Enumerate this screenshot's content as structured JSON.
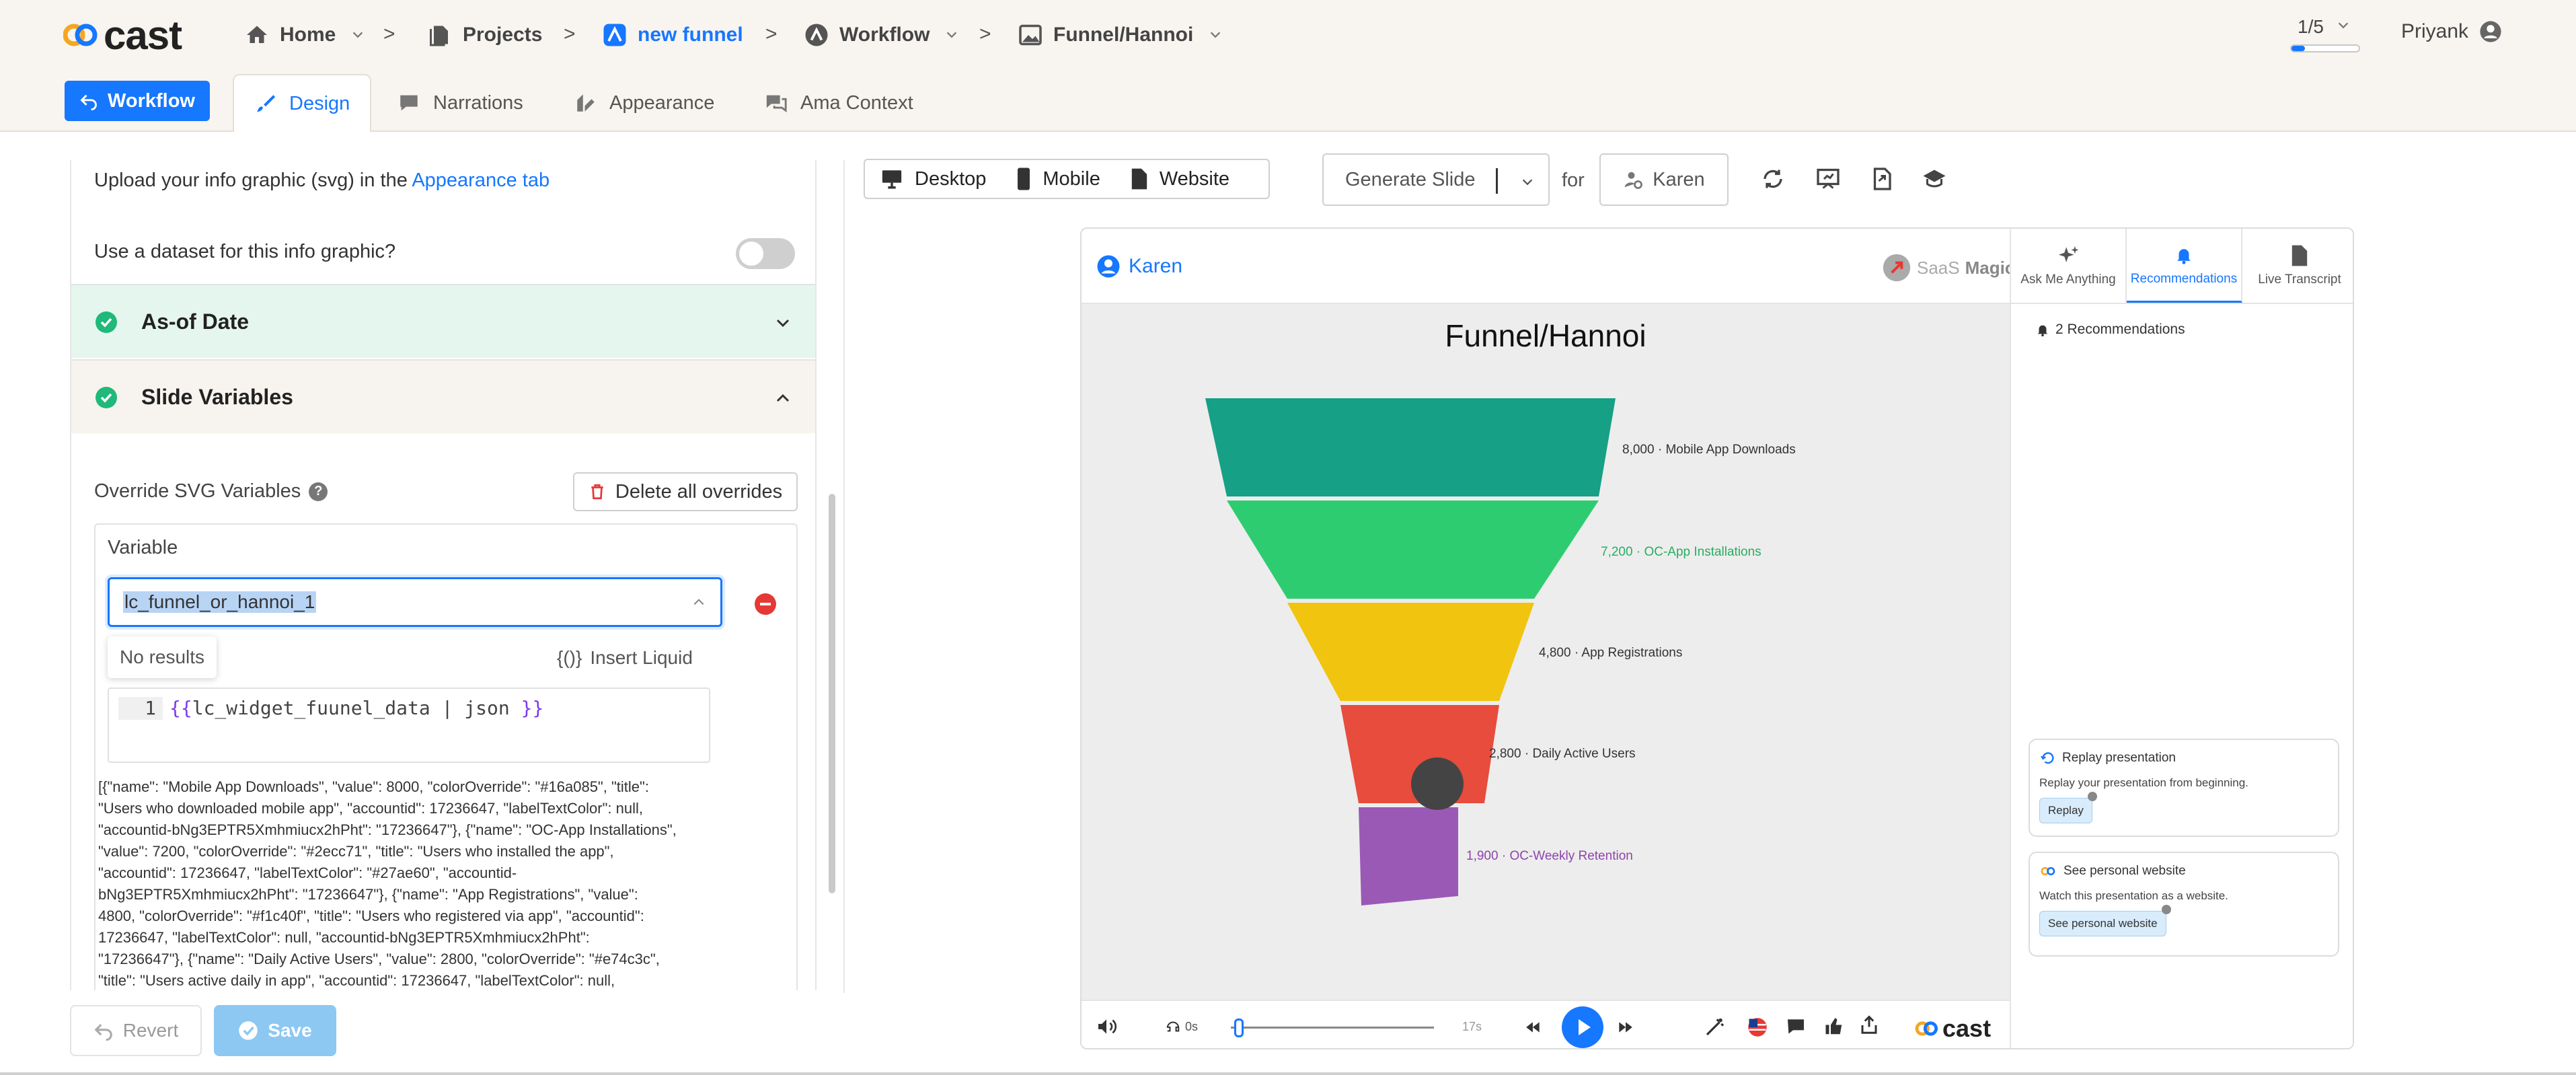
{
  "app": {
    "logo_text": "cast"
  },
  "breadcrumb": [
    {
      "label": "Home"
    },
    {
      "label": "Projects"
    },
    {
      "label": "new funnel"
    },
    {
      "label": "Workflow"
    },
    {
      "label": "Funnel/Hannoi"
    }
  ],
  "pager": {
    "text": "1/5",
    "progress": 0.2
  },
  "user": {
    "name": "Priyank"
  },
  "tabs": {
    "workflow_button": "Workflow",
    "items": [
      "Design",
      "Narrations",
      "Appearance",
      "Ama Context"
    ],
    "active": "Design"
  },
  "left_panel": {
    "upload_text": "Upload your info graphic (svg) in the",
    "upload_link": "Appearance tab",
    "dataset_question": "Use a dataset for this info graphic?",
    "dataset_enabled": false,
    "sections": [
      {
        "title": "As-of Date",
        "expanded": false
      },
      {
        "title": "Slide Variables",
        "expanded": true
      }
    ],
    "override_label": "Override SVG Variables",
    "help_icon": "?",
    "delete_all_label": "Delete all overrides",
    "variable_label": "Variable",
    "variable_value": "lc_funnel_or_hannoi_1",
    "no_results": "No results",
    "insert_liquid_icon": "{()}",
    "insert_liquid": "Insert Liquid",
    "code_line_number": "1",
    "code_open": "{{",
    "code_body": "lc_widget_fuunel_data | json ",
    "code_close": "}}",
    "json_preview": "[{\"name\": \"Mobile App Downloads\", \"value\": 8000, \"colorOverride\": \"#16a085\", \"title\": \"Users who downloaded mobile app\", \"accountid\": 17236647, \"labelTextColor\": null, \"accountid-bNg3EPTR5Xmhmiucx2hPht\": \"17236647\"}, {\"name\": \"OC-App Installations\", \"value\": 7200, \"colorOverride\": \"#2ecc71\", \"title\": \"Users who installed the app\", \"accountid\": 17236647, \"labelTextColor\": \"#27ae60\", \"accountid-bNg3EPTR5Xmhmiucx2hPht\": \"17236647\"}, {\"name\": \"App Registrations\", \"value\": 4800, \"colorOverride\": \"#f1c40f\", \"title\": \"Users who registered via app\", \"accountid\": 17236647, \"labelTextColor\": null, \"accountid-bNg3EPTR5Xmhmiucx2hPht\": \"17236647\"}, {\"name\": \"Daily Active Users\", \"value\": 2800, \"colorOverride\": \"#e74c3c\", \"title\": \"Users active daily in app\", \"accountid\": 17236647, \"labelTextColor\": null, \"accountid-",
    "revert_label": "Revert",
    "save_label": "Save"
  },
  "preview": {
    "devices": [
      "Desktop",
      "Mobile",
      "Website"
    ],
    "generate_label": "Generate Slide",
    "for_label": "for",
    "persona": "Karen",
    "tool_icons": [
      "refresh-icon",
      "present-icon",
      "export-icon",
      "learn-icon"
    ]
  },
  "player": {
    "viewer": "Karen",
    "brand": {
      "light": "SaaS",
      "bold": "Magic"
    },
    "slide_title": "Funnel/Hannoi",
    "funnel": [
      {
        "value": "8,000",
        "name": "Mobile App Downloads",
        "color": "#16a085",
        "label_color": "#333333"
      },
      {
        "value": "7,200",
        "name": "OC-App Installations",
        "color": "#2ecc71",
        "label_color": "#27ae60"
      },
      {
        "value": "4,800",
        "name": "App Registrations",
        "color": "#f1c40f",
        "label_color": "#333333"
      },
      {
        "value": "2,800",
        "name": "Daily Active Users",
        "color": "#e74c3c",
        "label_color": "#333333"
      },
      {
        "value": "1,900",
        "name": "OC-Weekly Retention",
        "color": "#9b59b6",
        "label_color": "#8e44ad"
      }
    ],
    "side_tabs": [
      "Ask Me Anything",
      "Recommendations",
      "Live Transcript"
    ],
    "active_side_tab": "Recommendations",
    "recommendations_count": "2 Recommendations",
    "cards": [
      {
        "title": "Replay presentation",
        "desc": "Replay your presentation from beginning.",
        "button": "Replay"
      },
      {
        "title": "See personal website",
        "desc": "Watch this presentation as a website.",
        "button": "See personal website"
      }
    ],
    "controls": {
      "time_start": "0s",
      "time_end": "17s",
      "playback_fraction": 0.04,
      "logo": "cast"
    }
  },
  "colors": {
    "accent": "#1677ff",
    "success": "#1fb97a",
    "danger": "#e53935"
  }
}
